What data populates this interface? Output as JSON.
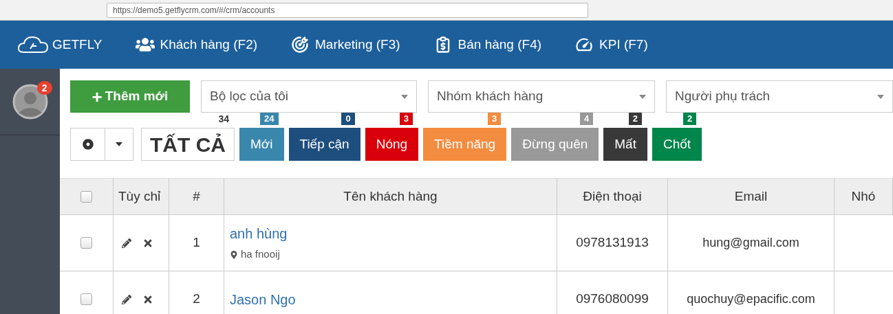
{
  "browser": {
    "url": "https://demo5.getflycrm.com/#/crm/accounts"
  },
  "nav": {
    "brand": "GETFLY",
    "items": [
      {
        "label": "Khách hàng (F2)",
        "kind": "people"
      },
      {
        "label": "Marketing (F3)",
        "kind": "target"
      },
      {
        "label": "Bán hàng (F4)",
        "kind": "sales"
      },
      {
        "label": "KPI (F7)",
        "kind": "gauge"
      }
    ]
  },
  "sidebar": {
    "notification_count": "2"
  },
  "toolbar": {
    "add_button": "Thêm mới",
    "add_icon": "+",
    "filters": [
      {
        "placeholder": "Bộ lọc của tôi"
      },
      {
        "placeholder": "Nhóm khách hàng"
      },
      {
        "placeholder": "Người phụ trách"
      }
    ]
  },
  "all_filter": {
    "label": "TẤT CẢ",
    "count": "34"
  },
  "statuses": [
    {
      "label": "Mới",
      "count": "24",
      "color": "#3a87ad"
    },
    {
      "label": "Tiếp cận",
      "count": "0",
      "color": "#1e4e7e"
    },
    {
      "label": "Nóng",
      "count": "3",
      "color": "#d9000b"
    },
    {
      "label": "Tiềm năng",
      "count": "3",
      "color": "#f48c3f"
    },
    {
      "label": "Đừng quên",
      "count": "4",
      "color": "#999999"
    },
    {
      "label": "Mất",
      "count": "2",
      "color": "#393939"
    },
    {
      "label": "Chốt",
      "count": "2",
      "color": "#00854a"
    }
  ],
  "table": {
    "select_all_checked": false,
    "columns": [
      "Tùy chỉ",
      "#",
      "Tên khách hàng",
      "Điện thoại",
      "Email",
      "Nhó"
    ],
    "rows": [
      {
        "checked": false,
        "number": "1",
        "name": "anh hùng",
        "address": "ha fnooij",
        "phone": "0978131913",
        "email": "hung@gmail.com"
      },
      {
        "checked": false,
        "number": "2",
        "name": "Jason Ngo",
        "phone": "0976080099",
        "email": "quochuy@epacific.com"
      }
    ]
  }
}
